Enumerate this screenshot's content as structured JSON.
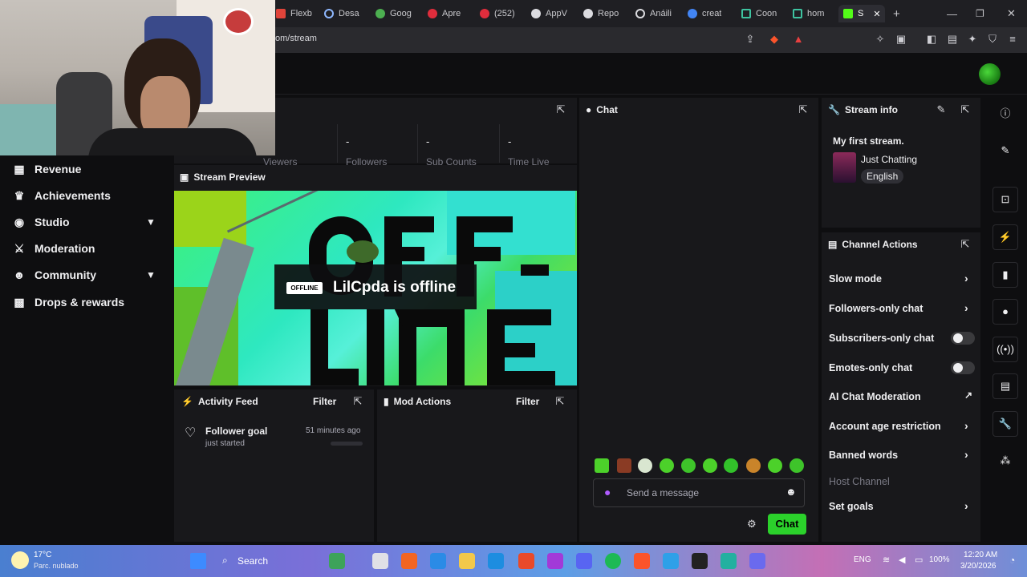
{
  "browser": {
    "tabs": [
      "Flexb",
      "Desa",
      "Goog",
      "Apre",
      "(252)",
      "AppV",
      "Repo",
      "Anáili",
      "creat",
      "Coon",
      "hom",
      "S"
    ],
    "url": "om/stream"
  },
  "sidebar": {
    "items": [
      {
        "label": "Revenue",
        "icon": "bar-chart-icon"
      },
      {
        "label": "Achievements",
        "icon": "trophy-icon"
      },
      {
        "label": "Studio",
        "icon": "camera-icon",
        "expandable": true
      },
      {
        "label": "Moderation",
        "icon": "sword-icon"
      },
      {
        "label": "Community",
        "icon": "people-icon",
        "expandable": true
      },
      {
        "label": "Drops & rewards",
        "icon": "gift-icon"
      }
    ]
  },
  "stats": {
    "columns": [
      {
        "value": "",
        "label": "Viewers"
      },
      {
        "value": "-",
        "label": "Followers"
      },
      {
        "value": "-",
        "label": "Sub Counts"
      },
      {
        "value": "-",
        "label": "Time Live"
      }
    ]
  },
  "preview": {
    "title": "Stream Preview",
    "badge": "OFFLINE",
    "status": "LilCpda is offline"
  },
  "activity": {
    "title": "Activity Feed",
    "filter": "Filter",
    "item": {
      "title": "Follower goal",
      "subtitle": "just started",
      "time": "51 minutes ago"
    }
  },
  "mod": {
    "title": "Mod Actions",
    "filter": "Filter"
  },
  "chat": {
    "title": "Chat",
    "placeholder": "Send a message",
    "button": "Chat"
  },
  "stream_info": {
    "title": "Stream info",
    "stream_title": "My first stream.",
    "category": "Just Chatting",
    "language": "English"
  },
  "channel_actions": {
    "title": "Channel Actions",
    "rows": [
      {
        "label": "Slow mode",
        "control": "chevron"
      },
      {
        "label": "Followers-only chat",
        "control": "chevron"
      },
      {
        "label": "Subscribers-only chat",
        "control": "toggle"
      },
      {
        "label": "Emotes-only chat",
        "control": "toggle"
      },
      {
        "label": "AI Chat Moderation",
        "control": "external"
      },
      {
        "label": "Account age restriction",
        "control": "chevron"
      },
      {
        "label": "Banned words",
        "control": "chevron"
      },
      {
        "label": "Host Channel",
        "control": "disabled"
      },
      {
        "label": "Set goals",
        "control": "chevron"
      }
    ]
  },
  "taskbar": {
    "weather_temp": "17°C",
    "weather_desc": "Parc. nublado",
    "search": "Search",
    "lang": "ENG",
    "battery": "100%",
    "time": "12:20 AM",
    "date": "3/20/2026"
  },
  "colors": {
    "accent": "#2bd12b",
    "panel": "#18181b",
    "background": "#0e0e10"
  }
}
